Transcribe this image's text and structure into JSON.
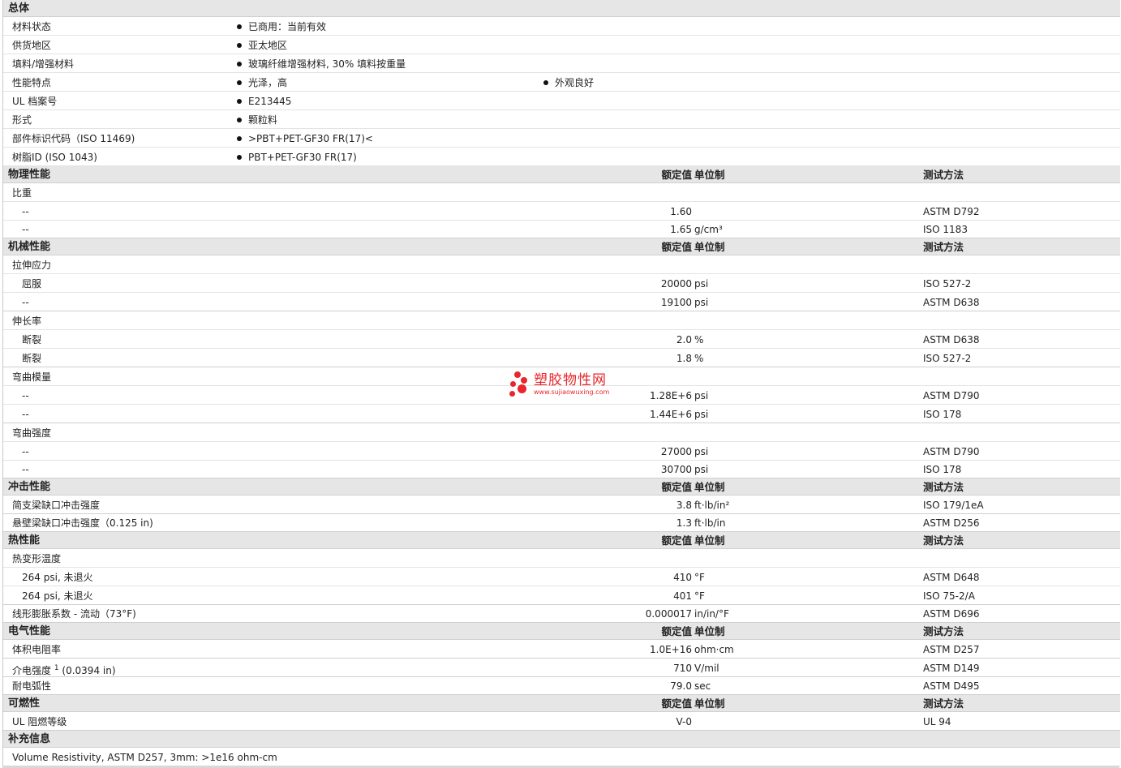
{
  "sections": {
    "general": {
      "title": "总体",
      "rows": [
        {
          "label": "材料状态",
          "b1": "已商用：当前有效"
        },
        {
          "label": "供货地区",
          "b1": "亚太地区"
        },
        {
          "label": "填料/增强材料",
          "b1": "玻璃纤维增强材料, 30% 填料按重量"
        },
        {
          "label": "性能特点",
          "b1": "光泽，高",
          "b2": "外观良好"
        },
        {
          "label": "UL 档案号",
          "b1": "E213445"
        },
        {
          "label": "形式",
          "b1": "颗粒料"
        },
        {
          "label": "部件标识代码（ISO 11469)",
          "b1": ">PBT+PET-GF30 FR(17)<"
        },
        {
          "label": "树脂ID (ISO 1043)",
          "b1": "PBT+PET-GF30 FR(17)"
        }
      ]
    },
    "headers": {
      "value": "额定值",
      "unit": "单位制",
      "test": "测试方法"
    },
    "physical": {
      "title": "物理性能",
      "group": "比重",
      "rows": [
        {
          "label": "--",
          "value": "1.60",
          "unit": "",
          "test": "ASTM D792"
        },
        {
          "label": "--",
          "value": "1.65",
          "unit": "g/cm³",
          "test": "ISO 1183"
        }
      ]
    },
    "mechanical": {
      "title": "机械性能",
      "groups": [
        {
          "name": "拉伸应力",
          "rows": [
            {
              "label": "屈服",
              "value": "20000",
              "unit": "psi",
              "test": "ISO 527-2"
            },
            {
              "label": "--",
              "value": "19100",
              "unit": "psi",
              "test": "ASTM D638"
            }
          ]
        },
        {
          "name": "伸长率",
          "rows": [
            {
              "label": "断裂",
              "value": "2.0",
              "unit": "%",
              "test": "ASTM D638"
            },
            {
              "label": "断裂",
              "value": "1.8",
              "unit": "%",
              "test": "ISO 527-2"
            }
          ]
        },
        {
          "name": "弯曲模量",
          "rows": [
            {
              "label": "--",
              "value": "1.28E+6",
              "unit": "psi",
              "test": "ASTM D790"
            },
            {
              "label": "--",
              "value": "1.44E+6",
              "unit": "psi",
              "test": "ISO 178"
            }
          ]
        },
        {
          "name": "弯曲强度",
          "rows": [
            {
              "label": "--",
              "value": "27000",
              "unit": "psi",
              "test": "ASTM D790"
            },
            {
              "label": "--",
              "value": "30700",
              "unit": "psi",
              "test": "ISO 178"
            }
          ]
        }
      ]
    },
    "impact": {
      "title": "冲击性能",
      "rows": [
        {
          "label": "简支梁缺口冲击强度",
          "value": "3.8",
          "unit": "ft·lb/in²",
          "test": "ISO 179/1eA"
        },
        {
          "label": "悬壁梁缺口冲击强度（0.125 in)",
          "value": "1.3",
          "unit": "ft·lb/in",
          "test": "ASTM D256"
        }
      ]
    },
    "thermal": {
      "title": "热性能",
      "group": "热变形温度",
      "rows": [
        {
          "label": "264 psi, 未退火",
          "value": "410",
          "unit": "°F",
          "test": "ASTM D648"
        },
        {
          "label": "264 psi, 未退火",
          "value": "401",
          "unit": "°F",
          "test": "ISO 75-2/A"
        }
      ],
      "extra": {
        "label": "线形膨胀系数 - 流动（73°F)",
        "value": "0.000017",
        "unit": "in/in/°F",
        "test": "ASTM D696"
      }
    },
    "electrical": {
      "title": "电气性能",
      "rows": [
        {
          "label": "体积电阻率",
          "value": "1.0E+16",
          "unit": "ohm·cm",
          "test": "ASTM D257"
        },
        {
          "label": "介电强度",
          "sup": "1",
          "label_tail": "(0.0394 in)",
          "value": "710",
          "unit": "V/mil",
          "test": "ASTM D149"
        },
        {
          "label": "耐电弧性",
          "value": "79.0",
          "unit": "sec",
          "test": "ASTM D495"
        }
      ]
    },
    "flammability": {
      "title": "可燃性",
      "rows": [
        {
          "label": "UL 阻燃等级",
          "value": "V-0",
          "unit": "",
          "test": "UL 94"
        }
      ]
    },
    "supplemental": {
      "title": "补充信息",
      "text": "Volume Resistivity, ASTM D257, 3mm: >1e16 ohm-cm"
    }
  },
  "watermark": {
    "title": "塑胶物性网",
    "url": "www.sujiaowuxing.com",
    "color": "#e8262b"
  }
}
